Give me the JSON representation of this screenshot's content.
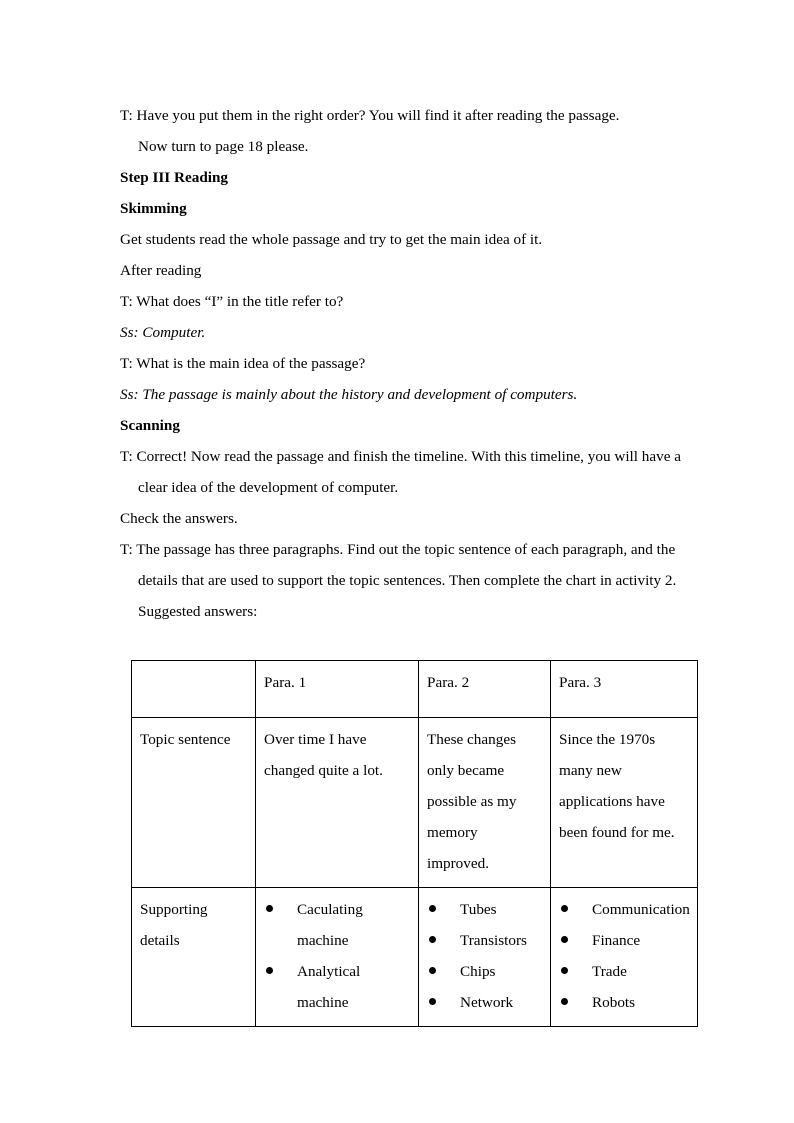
{
  "document": {
    "lines": [
      {
        "id": "l1",
        "text": "T: Have you put them in the right order? You will find it after reading the passage."
      },
      {
        "id": "l2",
        "text": "Now turn to page 18 please."
      },
      {
        "id": "l3",
        "text": "Step III Reading"
      },
      {
        "id": "l4",
        "text": "Skimming"
      },
      {
        "id": "l5",
        "text": "Get students read the whole passage and try to get the main idea of it."
      },
      {
        "id": "l6",
        "text": "After reading"
      },
      {
        "id": "l7",
        "text": "T: What does “I” in the title refer to?"
      },
      {
        "id": "l8",
        "text": "Ss: Computer."
      },
      {
        "id": "l9",
        "text": "T: What is the main idea of the passage?"
      },
      {
        "id": "l10",
        "text": "Ss: The passage is mainly about the history and development of computers."
      },
      {
        "id": "l11",
        "text": "Scanning"
      },
      {
        "id": "l12",
        "text": "T: Correct! Now read the passage and finish the timeline. With this timeline, you will have a clear idea of the development of computer."
      },
      {
        "id": "l13",
        "text": "Check the answers."
      },
      {
        "id": "l14",
        "text": "T: The passage has three paragraphs. Find out the topic sentence of each paragraph, and the details that are used to support the topic sentences. Then complete the chart in activity 2."
      },
      {
        "id": "l15",
        "text": "Suggested answers:"
      }
    ]
  },
  "table": {
    "headers": {
      "corner": "",
      "para1": "Para. 1",
      "para2": "Para. 2",
      "para3": "Para. 3"
    },
    "rows": [
      {
        "label": "Topic sentence",
        "para1": "Over time I have changed quite a lot.",
        "para2": "These changes only became possible as my memory improved.",
        "para3": "Since the 1970s many new applications have been found for me."
      },
      {
        "label": "Supporting details",
        "para1_items": [
          "Caculating machine",
          "Analytical machine"
        ],
        "para2_items": [
          "Tubes",
          "Transistors",
          "Chips",
          "Network"
        ],
        "para3_items": [
          "Communication",
          "Finance",
          "Trade",
          "Robots"
        ]
      }
    ]
  },
  "colors": {
    "page_background": "#ffffff",
    "text": "#000000",
    "table_border": "#000000",
    "bullet": "#000000"
  }
}
